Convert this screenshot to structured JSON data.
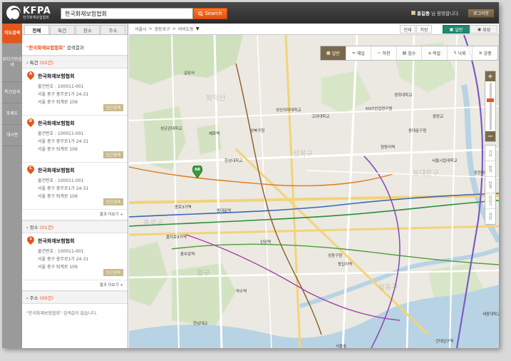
{
  "header": {
    "logo_text": "KFPA",
    "logo_sub": "한국화재보험협회",
    "search_value": "한국화재보험협회",
    "search_button": "Search",
    "user_name": "홍길동",
    "greeting": "님 환영합니다.",
    "logout": "로그아웃"
  },
  "leftnav": [
    "지도검색",
    "위치기반검색",
    "특건검색",
    "주제도",
    "게시판"
  ],
  "tabs": [
    "전체",
    "특건",
    "장소",
    "주소"
  ],
  "result_head": {
    "query": "\"한국화재보험협회\"",
    "suffix": " 검색결과"
  },
  "sections": {
    "special": {
      "title": "특건",
      "count": "(02건)"
    },
    "place": {
      "title": "장소",
      "count": "(01건)"
    },
    "address": {
      "title": "주소",
      "count": "(00건)"
    }
  },
  "items": [
    {
      "label": "A",
      "name": "한국화재보험협회",
      "no": "물건번호 : 100011-001",
      "addr1": "서울 중구 충무로1가 24-31",
      "addr2": "서울 중구 퇴계로 109",
      "more": "인근검색"
    },
    {
      "label": "B",
      "name": "한국화재보험협회",
      "no": "물건번호 : 100011-001",
      "addr1": "서울 중구 충무로1가 24-31",
      "addr2": "서울 중구 퇴계로 109",
      "more": "인근검색"
    },
    {
      "label": "C",
      "name": "한국화재보험협회",
      "no": "물건번호 : 100011-001",
      "addr1": "서울 중구 충무로1가 24-31",
      "addr2": "서울 중구 퇴계로 109",
      "more": "인근검색"
    },
    {
      "label": "1",
      "name": "한국화재보험협회",
      "no": "물건번호 : 100011-001",
      "addr1": "서울 중구 충무로1가 24-31",
      "addr2": "서울 중구 퇴계로 109",
      "more": "인근검색"
    }
  ],
  "see_more": "결과 더보기 +",
  "empty_msg": "\"한국화재보험협회\" 검색값이 없습니다.",
  "map": {
    "breadcrumb": [
      "서울시",
      ">",
      "영등포구",
      ">",
      "여의도동"
    ],
    "print": "인쇄",
    "save": "저장",
    "normal": "일반",
    "satellite": "위성",
    "themes": [
      "일반",
      "해일",
      "하천",
      "침수",
      "적설",
      "낙뢰",
      "강풍"
    ],
    "zoom_in": "+",
    "zoom_out": "−",
    "tools": [
      "거리",
      "면적",
      "반경",
      "지우기",
      "저장"
    ],
    "marker": "AB",
    "labels": [
      [
        "길상사",
        77,
        49
      ],
      [
        "성북구청",
        170,
        130
      ],
      [
        "성신여자대학교",
        206,
        101
      ],
      [
        "고려대학교",
        256,
        110
      ],
      [
        "KIST산업연구원",
        332,
        99
      ],
      [
        "경희대학교",
        372,
        80
      ],
      [
        "성균관대학교",
        44,
        127
      ],
      [
        "혜화역",
        112,
        134
      ],
      [
        "한성대학교",
        134,
        172
      ],
      [
        "성동구청",
        279,
        305
      ],
      [
        "왕십리역",
        293,
        317
      ],
      [
        "동대문역",
        123,
        242
      ],
      [
        "신당역",
        184,
        286
      ],
      [
        "종로3가역",
        64,
        237
      ],
      [
        "을지로3가역",
        52,
        279
      ],
      [
        "충무로역",
        72,
        303
      ],
      [
        "약수역",
        150,
        355
      ],
      [
        "한남대교",
        90,
        400
      ],
      [
        "서울숲",
        290,
        432
      ],
      [
        "청량리역",
        353,
        153
      ],
      [
        "서울시립대학교",
        425,
        172
      ],
      [
        "중랑교",
        426,
        110
      ],
      [
        "장한평역",
        484,
        189
      ],
      [
        "동대문구청",
        392,
        130
      ],
      [
        "세종대학교",
        496,
        387
      ],
      [
        "건대입구역",
        430,
        425
      ]
    ],
    "areas": [
      [
        "북악산",
        108,
        80
      ],
      [
        "성북구",
        230,
        158
      ],
      [
        "종로구",
        20,
        255
      ],
      [
        "중구",
        95,
        325
      ],
      [
        "성동구",
        350,
        345
      ],
      [
        "동대문구",
        398,
        185
      ]
    ]
  }
}
